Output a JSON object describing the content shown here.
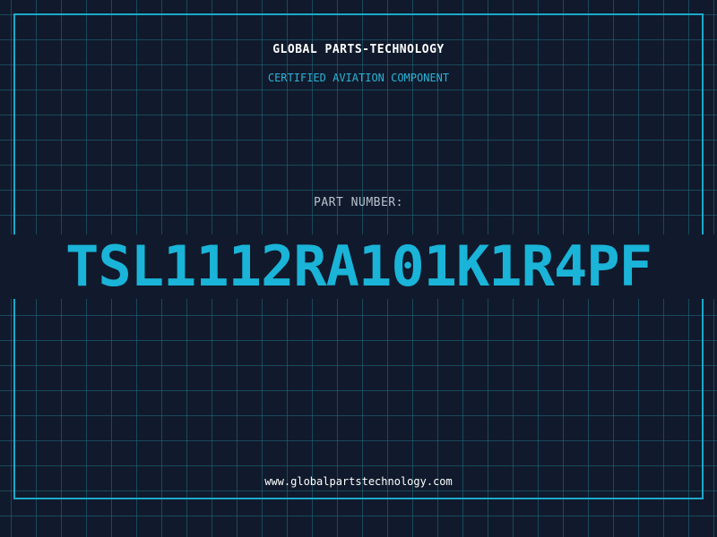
{
  "header": {
    "title": "GLOBAL PARTS-TECHNOLOGY",
    "subtitle": "CERTIFIED AVIATION COMPONENT"
  },
  "part": {
    "label": "PART NUMBER:",
    "number": "TSL1112RA101K1R4PF"
  },
  "footer": {
    "url": "www.globalpartstechnology.com"
  },
  "colors": {
    "background": "#101a2c",
    "accent": "#1ab4d8",
    "grid": "#236e82",
    "frame": "#1ca9c9"
  }
}
